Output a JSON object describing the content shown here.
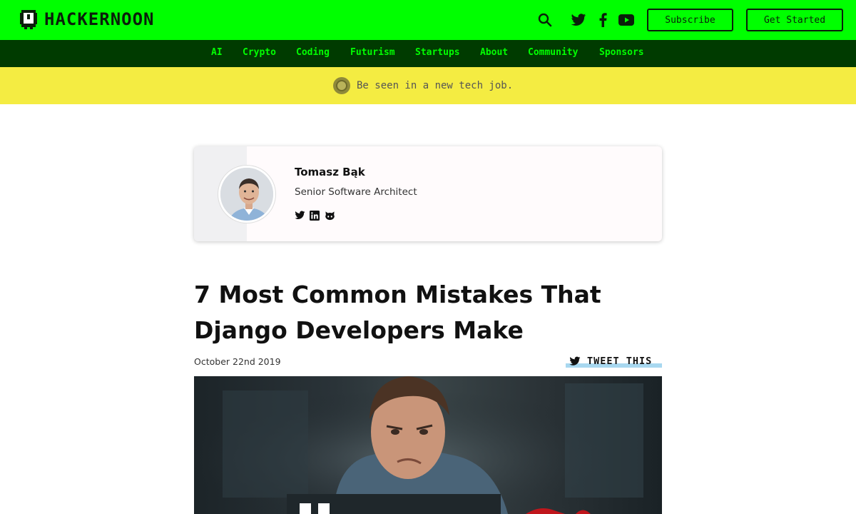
{
  "header": {
    "logo_text": "HACKERNOON",
    "icons": [
      "search-icon",
      "twitter-icon",
      "facebook-icon",
      "youtube-icon"
    ],
    "subscribe_label": "Subscribe",
    "get_started_label": "Get Started",
    "bg_color": "#00ff00"
  },
  "nav": {
    "items": [
      {
        "label": "AI"
      },
      {
        "label": "Crypto"
      },
      {
        "label": "Coding"
      },
      {
        "label": "Futurism"
      },
      {
        "label": "Startups"
      },
      {
        "label": "About"
      },
      {
        "label": "Community"
      },
      {
        "label": "Sponsors"
      }
    ],
    "bg_color": "#003b00",
    "text_color": "#00ff00"
  },
  "banner": {
    "text": "Be seen in a new tech job.",
    "bg_color": "#f4ec42"
  },
  "author": {
    "name": "Tomasz Bąk",
    "role": "Senior Software Architect",
    "socials": [
      "twitter-icon",
      "linkedin-icon",
      "github-icon"
    ]
  },
  "article": {
    "title": "7 Most Common Mistakes That Django Developers Make",
    "date": "October 22nd 2019",
    "tweet_label": "TWEET THIS"
  }
}
